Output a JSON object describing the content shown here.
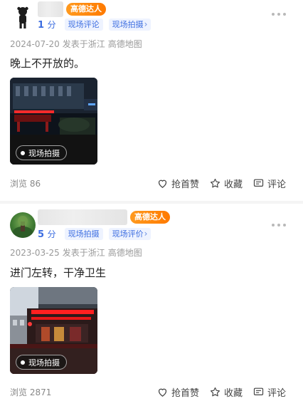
{
  "colors": {
    "accent": "#3c6de0",
    "badge": "#ff8a00",
    "meta": "#999999"
  },
  "reviews": [
    {
      "badge": "高德达人",
      "score": "1",
      "score_unit": "分",
      "tags": [
        "现场评论",
        "现场拍摄"
      ],
      "date": "2024-07-20",
      "location": "发表于浙江",
      "source": "高德地图",
      "content": "晚上不开放的。",
      "photo_label": "现场拍摄",
      "views": "浏览 86",
      "actions": {
        "like": "抢首赞",
        "favorite": "收藏",
        "comment": "评论"
      },
      "icons": {
        "more": "more-dots-icon",
        "like": "heart-icon",
        "favorite": "star-icon",
        "comment": "comment-icon"
      }
    },
    {
      "badge": "高德达人",
      "score": "5",
      "score_unit": "分",
      "tags": [
        "现场拍摄",
        "现场评价"
      ],
      "date": "2023-03-25",
      "location": "发表于浙江",
      "source": "高德地图",
      "content": "进门左转，干净卫生",
      "photo_label": "现场拍摄",
      "views": "浏览 2871",
      "actions": {
        "like": "抢首赞",
        "favorite": "收藏",
        "comment": "评论"
      },
      "icons": {
        "more": "more-dots-icon",
        "like": "heart-icon",
        "favorite": "star-icon",
        "comment": "comment-icon"
      }
    }
  ]
}
